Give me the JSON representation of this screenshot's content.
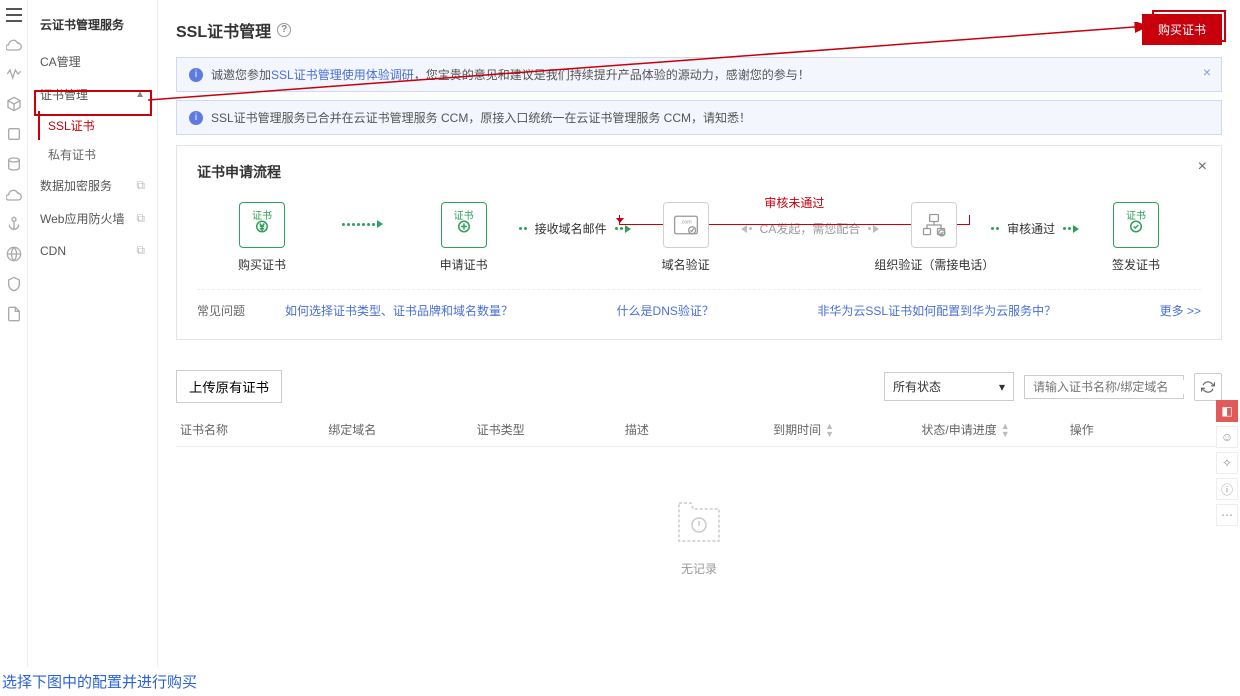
{
  "sidebar": {
    "title": "云证书管理服务",
    "ca": "CA管理",
    "cert_mgmt": "证书管理",
    "ssl": "SSL证书",
    "private": "私有证书",
    "data_enc": "数据加密服务",
    "waf": "Web应用防火墙",
    "cdn": "CDN"
  },
  "page": {
    "title": "SSL证书管理",
    "buy_btn": "购买证书"
  },
  "notice1": {
    "pre": "诚邀您参加",
    "link": "SSL证书管理使用体验调研",
    "post": "，您宝贵的意见和建议是我们持续提升产品体验的源动力，感谢您的参与！"
  },
  "notice2": {
    "text": "SSL证书管理服务已合并在云证书管理服务 CCM，原接入口统统一在云证书管理服务 CCM，请知悉！"
  },
  "flow": {
    "title": "证书申请流程",
    "fail": "审核未通过",
    "steps": {
      "buy": "购买证书",
      "apply": "申请证书",
      "recv": "接收域名邮件",
      "domain": "域名验证",
      "ca": "CA发起，需您配合",
      "org": "组织验证（需接电话）",
      "pass": "审核通过",
      "issue": "签发证书"
    },
    "cert_badge": "证书"
  },
  "faq": {
    "label": "常见问题",
    "q1": "如何选择证书类型、证书品牌和域名数量？",
    "q2": "什么是DNS验证？",
    "q3": "非华为云SSL证书如何配置到华为云服务中？",
    "more": "更多 >>"
  },
  "toolbar": {
    "upload": "上传原有证书",
    "status": "所有状态",
    "search_ph": "请输入证书名称/绑定域名"
  },
  "table": {
    "c1": "证书名称",
    "c2": "绑定域名",
    "c3": "证书类型",
    "c4": "描述",
    "c5": "到期时间",
    "c6": "状态/申请进度",
    "c7": "操作"
  },
  "empty": "无记录",
  "caption": "选择下图中的配置并进行购买"
}
